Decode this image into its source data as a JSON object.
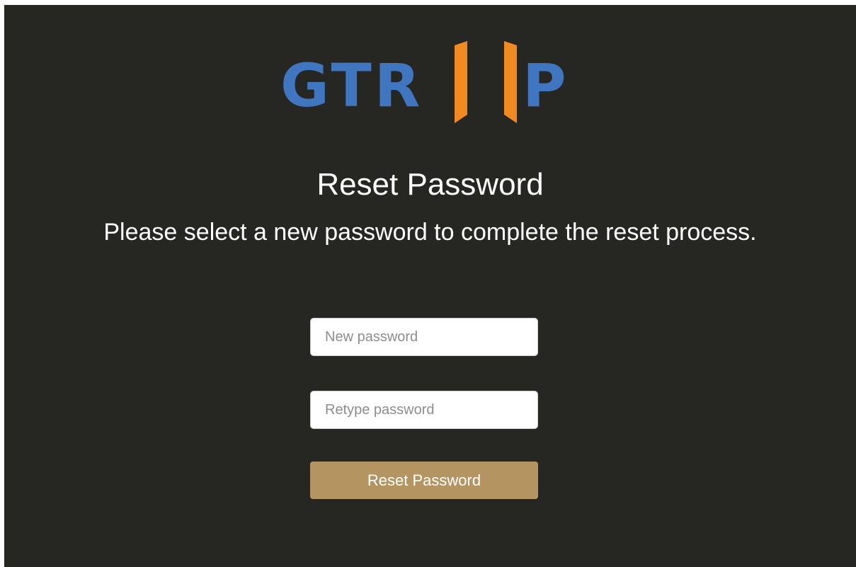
{
  "brand": {
    "logo_text_left": "GTR",
    "logo_text_right": "P",
    "blue": "#3f76bf",
    "orange": "#f28a22"
  },
  "page": {
    "title": "Reset Password",
    "subtitle": "Please select a new password to complete the reset process.",
    "background": "#262622"
  },
  "form": {
    "new_password": {
      "value": "",
      "placeholder": "New password"
    },
    "retype_password": {
      "value": "",
      "placeholder": "Retype password"
    },
    "submit_label": "Reset Password",
    "submit_color": "#b49562"
  }
}
